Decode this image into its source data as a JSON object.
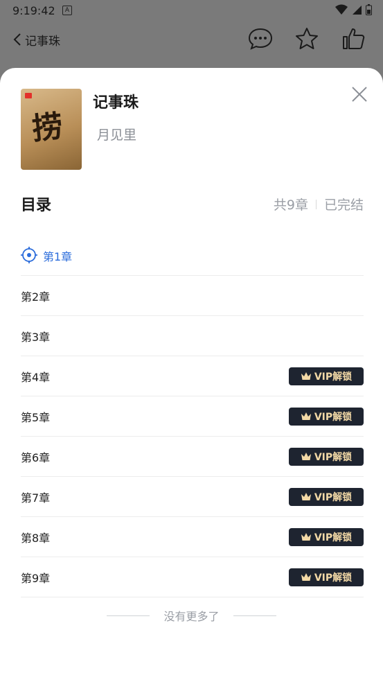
{
  "status_bar": {
    "time": "9:19:42"
  },
  "top_nav": {
    "back_label": "记事珠"
  },
  "book": {
    "title": "记事珠",
    "author": "月见里"
  },
  "toc": {
    "title": "目录",
    "chapter_count": "共9章",
    "status": "已完结",
    "chapters": [
      {
        "label": "第1章",
        "current": true,
        "locked": false
      },
      {
        "label": "第2章",
        "locked": false
      },
      {
        "label": "第3章",
        "locked": false
      },
      {
        "label": "第4章",
        "locked": true
      },
      {
        "label": "第5章",
        "locked": true
      },
      {
        "label": "第6章",
        "locked": true
      },
      {
        "label": "第7章",
        "locked": true
      },
      {
        "label": "第8章",
        "locked": true
      },
      {
        "label": "第9章",
        "locked": true
      }
    ],
    "vip_label": "VIP解锁",
    "end_text": "没有更多了"
  },
  "colors": {
    "accent": "#2b6cdb",
    "vip_bg": "#1e2430",
    "vip_text": "#f3d9a6"
  }
}
